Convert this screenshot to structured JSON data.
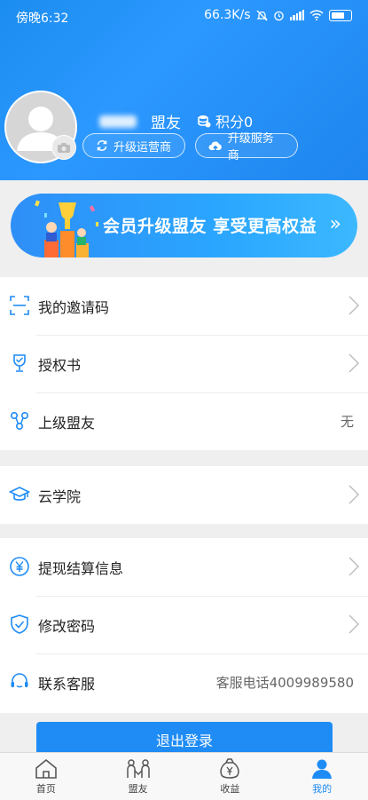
{
  "status_bar": {
    "time": "傍晚6:32",
    "speed": "66.3K/s"
  },
  "profile": {
    "nickname": "盟友",
    "points": "积分0"
  },
  "buttons": {
    "upgrade_operator": "升级运营商",
    "upgrade_service": "升级服务商"
  },
  "banner": {
    "text": "会员升级盟友 享受更高权益",
    "arrow": "»"
  },
  "menu": {
    "invite_code": "我的邀请码",
    "authorization": "授权书",
    "superior": "上级盟友",
    "superior_value": "无",
    "academy": "云学院",
    "withdraw_info": "提现结算信息",
    "change_password": "修改密码",
    "customer_service": "联系客服",
    "customer_service_value": "客服电话4009989580"
  },
  "logout_label": "退出登录",
  "tabs": [
    {
      "label": "首页",
      "icon": "home-icon"
    },
    {
      "label": "盟友",
      "icon": "friends-icon"
    },
    {
      "label": "收益",
      "icon": "money-bag-icon"
    },
    {
      "label": "我的",
      "icon": "user-icon",
      "active": true
    }
  ],
  "colors": {
    "primary": "#1f8cf5",
    "background": "#efefef"
  }
}
